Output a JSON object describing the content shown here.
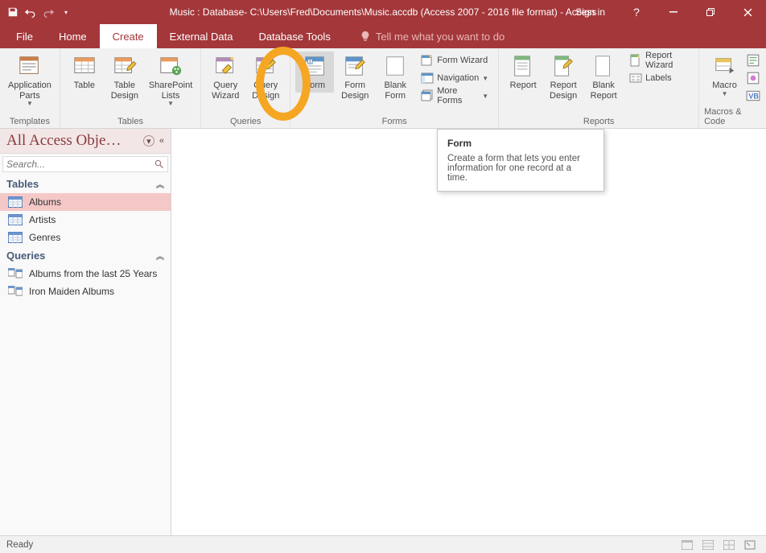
{
  "titlebar": {
    "title": "Music : Database- C:\\Users\\Fred\\Documents\\Music.accdb (Access 2007 - 2016 file format) - Access",
    "signin": "Sign in"
  },
  "tabs": {
    "file": "File",
    "home": "Home",
    "create": "Create",
    "externaldata": "External Data",
    "databasetools": "Database Tools",
    "tellme": "Tell me what you want to do"
  },
  "ribbon": {
    "templates": {
      "label": "Templates",
      "application_parts": "Application\nParts"
    },
    "tables": {
      "label": "Tables",
      "table": "Table",
      "table_design": "Table\nDesign",
      "sharepoint_lists": "SharePoint\nLists"
    },
    "queries": {
      "label": "Queries",
      "query_wizard": "Query\nWizard",
      "query_design": "Query\nDesign"
    },
    "forms": {
      "label": "Forms",
      "form": "Form",
      "form_design": "Form\nDesign",
      "blank_form": "Blank\nForm",
      "form_wizard": "Form Wizard",
      "navigation": "Navigation",
      "more_forms": "More Forms"
    },
    "reports": {
      "label": "Reports",
      "report": "Report",
      "report_design": "Report\nDesign",
      "blank_report": "Blank\nReport",
      "report_wizard": "Report Wizard",
      "labels": "Labels"
    },
    "macros": {
      "label": "Macros & Code",
      "macro": "Macro"
    }
  },
  "nav": {
    "title": "All Access Obje…",
    "search_placeholder": "Search...",
    "sections": {
      "tables": "Tables",
      "queries": "Queries"
    },
    "items": {
      "albums": "Albums",
      "artists": "Artists",
      "genres": "Genres",
      "albums25": "Albums from the last 25 Years",
      "ironmaiden": "Iron Maiden Albums"
    }
  },
  "tooltip": {
    "title": "Form",
    "body": "Create a form that lets you enter information for one record at a time."
  },
  "status": {
    "ready": "Ready"
  },
  "colors": {
    "accent": "#a4373a",
    "highlight": "#f5a623"
  }
}
